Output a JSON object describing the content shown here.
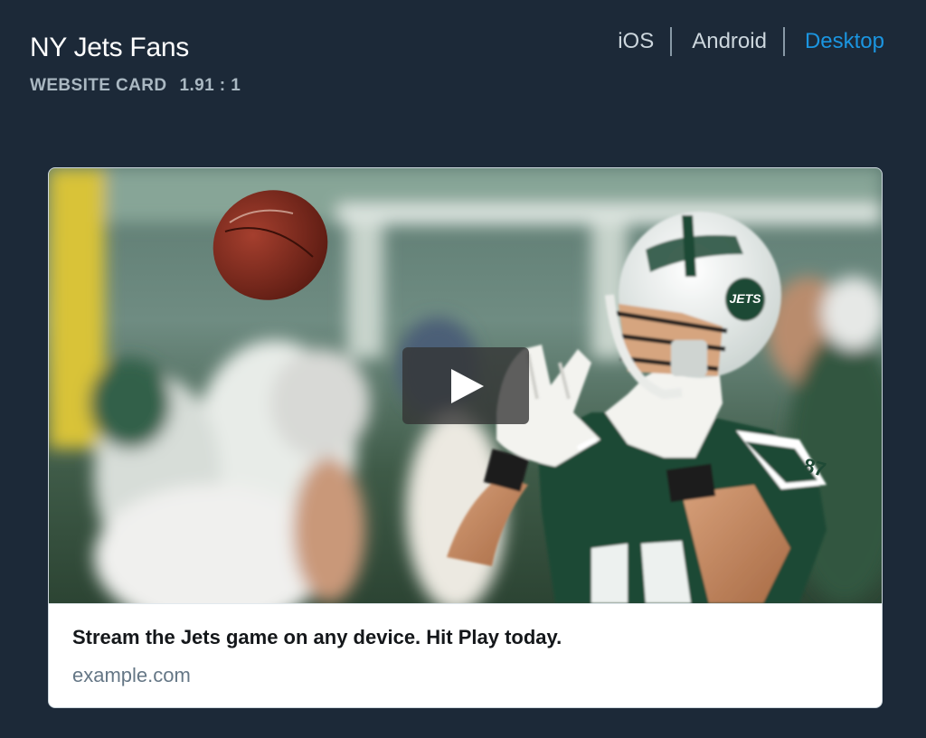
{
  "header": {
    "title": "NY Jets Fans",
    "card_type": "WEBSITE CARD",
    "ratio": "1.91 : 1"
  },
  "platform_tabs": [
    {
      "label": "iOS",
      "active": false
    },
    {
      "label": "Android",
      "active": false
    },
    {
      "label": "Desktop",
      "active": true
    }
  ],
  "card": {
    "image_description": "Jets player catching a football",
    "helmet_text": "JETS",
    "jersey_number": "87",
    "play_icon": "play-icon",
    "title": "Stream the Jets game on any device. Hit Play today.",
    "domain": "example.com"
  },
  "colors": {
    "background": "#1c2938",
    "active_tab": "#1b95e0",
    "subtitle": "#aab8c2",
    "jets_green": "#1f4a36"
  }
}
